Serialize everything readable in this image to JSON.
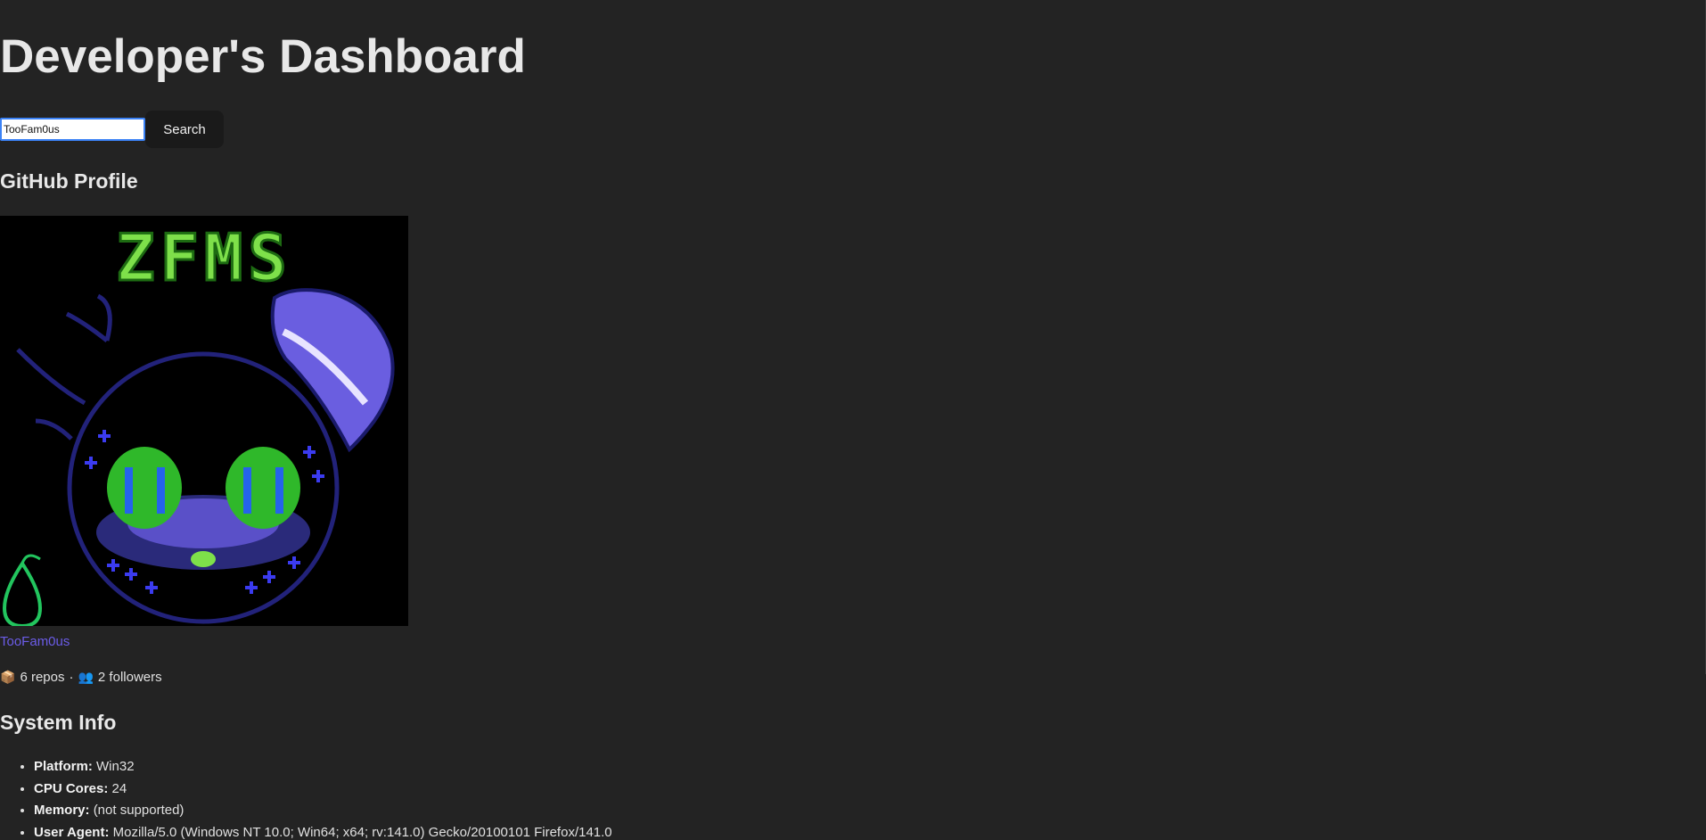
{
  "header": {
    "title": "Developer's Dashboard"
  },
  "search": {
    "value": "TooFam0us",
    "button_label": "Search"
  },
  "github": {
    "section_title": "GitHub Profile",
    "avatar_text": "ZFMS",
    "username": "TooFam0us",
    "repos_icon": "📦",
    "repos_text": "6 repos",
    "separator": "·",
    "followers_icon": "👥",
    "followers_text": "2 followers"
  },
  "system": {
    "section_title": "System Info",
    "items": [
      {
        "label": "Platform:",
        "value": "Win32"
      },
      {
        "label": "CPU Cores:",
        "value": "24"
      },
      {
        "label": "Memory:",
        "value": "(not supported)"
      },
      {
        "label": "User Agent:",
        "value": "Mozilla/5.0 (Windows NT 10.0; Win64; x64; rv:141.0) Gecko/20100101 Firefox/141.0"
      }
    ]
  },
  "colors": {
    "background": "#232323",
    "link": "#6b5ce7",
    "input_focus": "#3b82f6",
    "button_bg": "#1a1a1a"
  }
}
